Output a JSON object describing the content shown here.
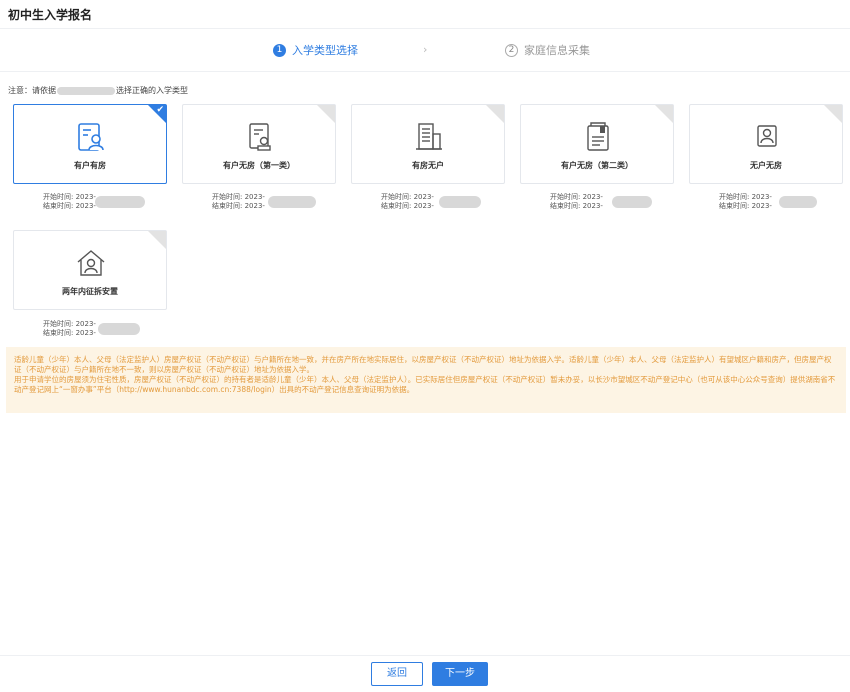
{
  "page": {
    "title": "初中生入学报名"
  },
  "steps": [
    {
      "num": "1",
      "label": "入学类型选择",
      "state": "active"
    },
    {
      "num": "2",
      "label": "家庭信息采集",
      "state": "inactive"
    }
  ],
  "steps_arrow": "›",
  "notice": {
    "prefix": "注意：请依据",
    "suffix": "选择正确的入学类型"
  },
  "cards": [
    {
      "label": "有户有房",
      "icon": "person-document-icon",
      "selected": true,
      "start": "开始时间: 2023-",
      "end": "结束时间: 2023-"
    },
    {
      "label": "有户无房（第一类）",
      "icon": "certificate-stamp-icon",
      "selected": false,
      "start": "开始时间: 2023-",
      "end": "结束时间: 2023-"
    },
    {
      "label": "有房无户",
      "icon": "building-icon",
      "selected": false,
      "start": "开始时间: 2023-",
      "end": "结束时间: 2023-"
    },
    {
      "label": "有户无房（第二类）",
      "icon": "booklet-icon",
      "selected": false,
      "start": "开始时间: 2023-",
      "end": "结束时间: 2023-"
    },
    {
      "label": "无户无房",
      "icon": "person-frame-icon",
      "selected": false,
      "start": "开始时间: 2023-",
      "end": "结束时间: 2023-"
    },
    {
      "label": "两年内征拆安置",
      "icon": "house-person-icon",
      "selected": false,
      "start": "开始时间: 2023-",
      "end": "结束时间: 2023-"
    }
  ],
  "info": {
    "line1": "适龄儿童（少年）本人、父母（法定监护人）房屋产权证（不动产权证）与户籍所在地一致，并在房产所在地实际居住，以房屋产权证（不动产权证）地址为依据入学。适龄儿童（少年）本人、父母（法定监护人）有望城区户籍和房产，但房屋产权证（不动产权证）与户籍所在地不一致，则以房屋产权证（不动产权证）地址为依据入学。",
    "line2": "用于申请学位的房屋须为住宅性质，房屋产权证（不动产权证）的持有者是适龄儿童（少年）本人、父母（法定监护人）。已实际居住但房屋产权证（不动产权证）暂未办妥，以长沙市望城区不动产登记中心（也可从该中心公众号查询）提供湖南省不动产登记网上“一窗办事”平台（http://www.hunanbdc.com.cn:7388/login）出具的不动产登记信息查询证明为依据。"
  },
  "footer": {
    "back_label": "返回",
    "next_label": "下一步"
  },
  "colors": {
    "accent": "#2f7de1",
    "notice_bg": "#fdf4e4",
    "notice_text": "#e39a3c"
  }
}
